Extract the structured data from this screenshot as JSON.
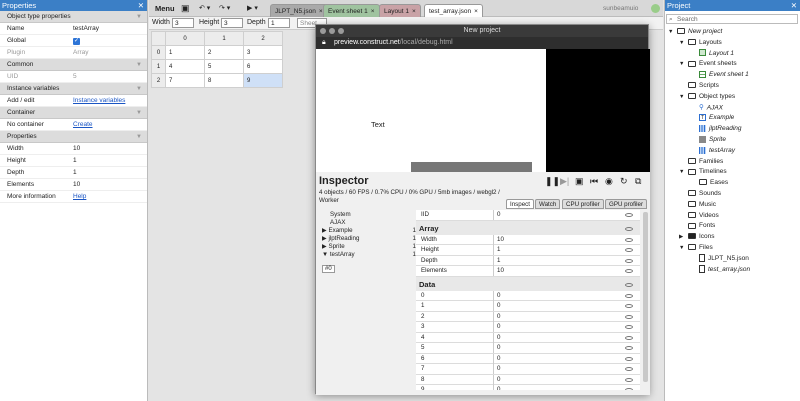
{
  "properties": {
    "title": "Properties",
    "rows": [
      {
        "type": "section",
        "label": "Object type properties"
      },
      {
        "type": "row",
        "key": "Name",
        "value": "testArray"
      },
      {
        "type": "check",
        "key": "Global",
        "value": ""
      },
      {
        "type": "row",
        "key": "Plugin",
        "value": "Array",
        "grey": true
      },
      {
        "type": "section",
        "label": "Common"
      },
      {
        "type": "row",
        "key": "UID",
        "value": "5",
        "grey": true
      },
      {
        "type": "section",
        "label": "Instance variables"
      },
      {
        "type": "link",
        "key": "Add / edit",
        "value": "Instance variables"
      },
      {
        "type": "section",
        "label": "Container"
      },
      {
        "type": "link",
        "key": "No container",
        "value": "Create"
      },
      {
        "type": "section",
        "label": "Properties"
      },
      {
        "type": "row",
        "key": "Width",
        "value": "10"
      },
      {
        "type": "row",
        "key": "Height",
        "value": "1"
      },
      {
        "type": "row",
        "key": "Depth",
        "value": "1"
      },
      {
        "type": "row",
        "key": "Elements",
        "value": "10"
      },
      {
        "type": "link",
        "key": "More information",
        "value": "Help"
      }
    ]
  },
  "toolbar": {
    "menu": "Menu",
    "undo": "↶ ▾",
    "redo": "↷ ▾",
    "play": "▶ ▾",
    "brand": "sunbeamuio",
    "tabs": [
      {
        "label": "JLPT_N5.json",
        "color": "#a9a9a9"
      },
      {
        "label": "Event sheet 1",
        "color": "#9fc39f"
      },
      {
        "label": "Layout 1",
        "color": "#c9a2a6"
      },
      {
        "label": "test_array.json",
        "color": "#ffffff"
      }
    ],
    "close": "×"
  },
  "array_editor": {
    "width_label": "Width",
    "width": "3",
    "height_label": "Height",
    "height": "3",
    "depth_label": "Depth",
    "depth": "1",
    "sheet_button": "Sheet",
    "col_headers": [
      "",
      "0",
      "1",
      "2"
    ],
    "rows": [
      [
        "0",
        "1",
        "2",
        "3"
      ],
      [
        "1",
        "4",
        "5",
        "6"
      ],
      [
        "2",
        "7",
        "8",
        "9"
      ]
    ]
  },
  "project": {
    "title": "Project",
    "search_placeholder": "Search",
    "items": [
      {
        "label": "New project",
        "depth": 0,
        "icon": "folder",
        "italic": true,
        "arrow": "▼"
      },
      {
        "label": "Layouts",
        "depth": 1,
        "icon": "folder",
        "arrow": "▼"
      },
      {
        "label": "Layout 1",
        "depth": 2,
        "icon": "layout",
        "italic": true
      },
      {
        "label": "Event sheets",
        "depth": 1,
        "icon": "folder",
        "arrow": "▼"
      },
      {
        "label": "Event sheet 1",
        "depth": 2,
        "icon": "event",
        "italic": true
      },
      {
        "label": "Scripts",
        "depth": 1,
        "icon": "folder"
      },
      {
        "label": "Object types",
        "depth": 1,
        "icon": "folder",
        "arrow": "▼"
      },
      {
        "label": "AJAX",
        "depth": 2,
        "icon": "ajax",
        "italic": true
      },
      {
        "label": "Example",
        "depth": 2,
        "icon": "text",
        "italic": true
      },
      {
        "label": "jlptReading",
        "depth": 2,
        "icon": "grid",
        "italic": true
      },
      {
        "label": "Sprite",
        "depth": 2,
        "icon": "sprite",
        "italic": true
      },
      {
        "label": "testArray",
        "depth": 2,
        "icon": "grid",
        "italic": true
      },
      {
        "label": "Families",
        "depth": 1,
        "icon": "folder"
      },
      {
        "label": "Timelines",
        "depth": 1,
        "icon": "folder",
        "arrow": "▼"
      },
      {
        "label": "Eases",
        "depth": 2,
        "icon": "folder"
      },
      {
        "label": "Sounds",
        "depth": 1,
        "icon": "folder"
      },
      {
        "label": "Music",
        "depth": 1,
        "icon": "folder"
      },
      {
        "label": "Videos",
        "depth": 1,
        "icon": "folder"
      },
      {
        "label": "Fonts",
        "depth": 1,
        "icon": "folder"
      },
      {
        "label": "Icons",
        "depth": 1,
        "icon": "folder-solid",
        "arrow": "▶"
      },
      {
        "label": "Files",
        "depth": 1,
        "icon": "folder",
        "arrow": "▼"
      },
      {
        "label": "JLPT_N5.json",
        "depth": 2,
        "icon": "file"
      },
      {
        "label": "test_array.json",
        "depth": 2,
        "icon": "file",
        "italic": true
      }
    ]
  },
  "debug_window": {
    "title": "New project",
    "url_host": "preview.construct.net",
    "url_path": "/local/debug.html",
    "canvas_text": "Text"
  },
  "inspector": {
    "title": "Inspector",
    "stats": "4 objects / 60 FPS / 0.7% CPU / 0% GPU / 5mb images / webgl2 / Worker",
    "tabs": [
      "Inspect",
      "Watch",
      "CPU profiler",
      "GPU profiler"
    ],
    "objects": [
      {
        "label": "System",
        "count": ""
      },
      {
        "label": "AJAX",
        "count": ""
      },
      {
        "label": "▶ Example",
        "count": "1"
      },
      {
        "label": "▶ jlptReading",
        "count": "1"
      },
      {
        "label": "▶ Sprite",
        "count": "1"
      },
      {
        "label": "▼ testArray",
        "count": "1"
      }
    ],
    "instance_tag": "#0",
    "top_row": {
      "key": "IID",
      "value": "0"
    },
    "array_section": "Array",
    "array_rows": [
      {
        "key": "Width",
        "value": "10"
      },
      {
        "key": "Height",
        "value": "1"
      },
      {
        "key": "Depth",
        "value": "1"
      },
      {
        "key": "Elements",
        "value": "10"
      }
    ],
    "data_section": "Data",
    "data_rows": [
      {
        "key": "0",
        "value": "0"
      },
      {
        "key": "1",
        "value": "0"
      },
      {
        "key": "2",
        "value": "0"
      },
      {
        "key": "3",
        "value": "0"
      },
      {
        "key": "4",
        "value": "0"
      },
      {
        "key": "5",
        "value": "0"
      },
      {
        "key": "6",
        "value": "0"
      },
      {
        "key": "7",
        "value": "0"
      },
      {
        "key": "8",
        "value": "0"
      },
      {
        "key": "9",
        "value": "0"
      }
    ]
  }
}
